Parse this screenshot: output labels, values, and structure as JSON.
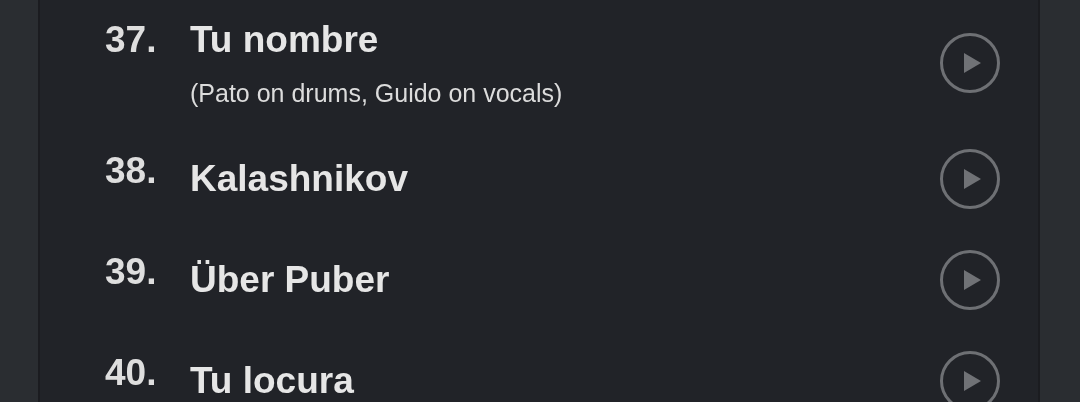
{
  "tracks": [
    {
      "number": "37.",
      "title": "Tu nombre",
      "note": "(Pato on drums, Guido on vocals)"
    },
    {
      "number": "38.",
      "title": "Kalashnikov"
    },
    {
      "number": "39.",
      "title": "Über Puber"
    },
    {
      "number": "40.",
      "title": "Tu locura"
    }
  ]
}
